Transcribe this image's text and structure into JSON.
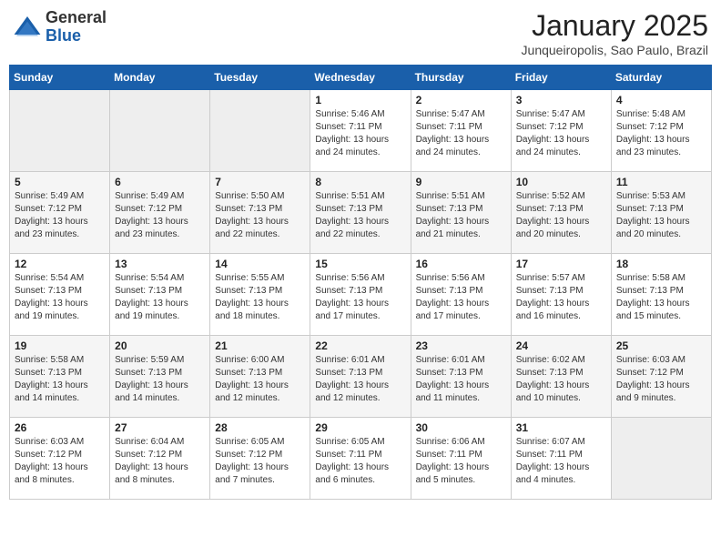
{
  "header": {
    "logo": {
      "general": "General",
      "blue": "Blue"
    },
    "title": "January 2025",
    "subtitle": "Junqueiropolis, Sao Paulo, Brazil"
  },
  "weekdays": [
    "Sunday",
    "Monday",
    "Tuesday",
    "Wednesday",
    "Thursday",
    "Friday",
    "Saturday"
  ],
  "weeks": [
    [
      {
        "day": "",
        "info": ""
      },
      {
        "day": "",
        "info": ""
      },
      {
        "day": "",
        "info": ""
      },
      {
        "day": "1",
        "info": "Sunrise: 5:46 AM\nSunset: 7:11 PM\nDaylight: 13 hours\nand 24 minutes."
      },
      {
        "day": "2",
        "info": "Sunrise: 5:47 AM\nSunset: 7:11 PM\nDaylight: 13 hours\nand 24 minutes."
      },
      {
        "day": "3",
        "info": "Sunrise: 5:47 AM\nSunset: 7:12 PM\nDaylight: 13 hours\nand 24 minutes."
      },
      {
        "day": "4",
        "info": "Sunrise: 5:48 AM\nSunset: 7:12 PM\nDaylight: 13 hours\nand 23 minutes."
      }
    ],
    [
      {
        "day": "5",
        "info": "Sunrise: 5:49 AM\nSunset: 7:12 PM\nDaylight: 13 hours\nand 23 minutes."
      },
      {
        "day": "6",
        "info": "Sunrise: 5:49 AM\nSunset: 7:12 PM\nDaylight: 13 hours\nand 23 minutes."
      },
      {
        "day": "7",
        "info": "Sunrise: 5:50 AM\nSunset: 7:13 PM\nDaylight: 13 hours\nand 22 minutes."
      },
      {
        "day": "8",
        "info": "Sunrise: 5:51 AM\nSunset: 7:13 PM\nDaylight: 13 hours\nand 22 minutes."
      },
      {
        "day": "9",
        "info": "Sunrise: 5:51 AM\nSunset: 7:13 PM\nDaylight: 13 hours\nand 21 minutes."
      },
      {
        "day": "10",
        "info": "Sunrise: 5:52 AM\nSunset: 7:13 PM\nDaylight: 13 hours\nand 20 minutes."
      },
      {
        "day": "11",
        "info": "Sunrise: 5:53 AM\nSunset: 7:13 PM\nDaylight: 13 hours\nand 20 minutes."
      }
    ],
    [
      {
        "day": "12",
        "info": "Sunrise: 5:54 AM\nSunset: 7:13 PM\nDaylight: 13 hours\nand 19 minutes."
      },
      {
        "day": "13",
        "info": "Sunrise: 5:54 AM\nSunset: 7:13 PM\nDaylight: 13 hours\nand 19 minutes."
      },
      {
        "day": "14",
        "info": "Sunrise: 5:55 AM\nSunset: 7:13 PM\nDaylight: 13 hours\nand 18 minutes."
      },
      {
        "day": "15",
        "info": "Sunrise: 5:56 AM\nSunset: 7:13 PM\nDaylight: 13 hours\nand 17 minutes."
      },
      {
        "day": "16",
        "info": "Sunrise: 5:56 AM\nSunset: 7:13 PM\nDaylight: 13 hours\nand 17 minutes."
      },
      {
        "day": "17",
        "info": "Sunrise: 5:57 AM\nSunset: 7:13 PM\nDaylight: 13 hours\nand 16 minutes."
      },
      {
        "day": "18",
        "info": "Sunrise: 5:58 AM\nSunset: 7:13 PM\nDaylight: 13 hours\nand 15 minutes."
      }
    ],
    [
      {
        "day": "19",
        "info": "Sunrise: 5:58 AM\nSunset: 7:13 PM\nDaylight: 13 hours\nand 14 minutes."
      },
      {
        "day": "20",
        "info": "Sunrise: 5:59 AM\nSunset: 7:13 PM\nDaylight: 13 hours\nand 14 minutes."
      },
      {
        "day": "21",
        "info": "Sunrise: 6:00 AM\nSunset: 7:13 PM\nDaylight: 13 hours\nand 12 minutes."
      },
      {
        "day": "22",
        "info": "Sunrise: 6:01 AM\nSunset: 7:13 PM\nDaylight: 13 hours\nand 12 minutes."
      },
      {
        "day": "23",
        "info": "Sunrise: 6:01 AM\nSunset: 7:13 PM\nDaylight: 13 hours\nand 11 minutes."
      },
      {
        "day": "24",
        "info": "Sunrise: 6:02 AM\nSunset: 7:13 PM\nDaylight: 13 hours\nand 10 minutes."
      },
      {
        "day": "25",
        "info": "Sunrise: 6:03 AM\nSunset: 7:12 PM\nDaylight: 13 hours\nand 9 minutes."
      }
    ],
    [
      {
        "day": "26",
        "info": "Sunrise: 6:03 AM\nSunset: 7:12 PM\nDaylight: 13 hours\nand 8 minutes."
      },
      {
        "day": "27",
        "info": "Sunrise: 6:04 AM\nSunset: 7:12 PM\nDaylight: 13 hours\nand 8 minutes."
      },
      {
        "day": "28",
        "info": "Sunrise: 6:05 AM\nSunset: 7:12 PM\nDaylight: 13 hours\nand 7 minutes."
      },
      {
        "day": "29",
        "info": "Sunrise: 6:05 AM\nSunset: 7:11 PM\nDaylight: 13 hours\nand 6 minutes."
      },
      {
        "day": "30",
        "info": "Sunrise: 6:06 AM\nSunset: 7:11 PM\nDaylight: 13 hours\nand 5 minutes."
      },
      {
        "day": "31",
        "info": "Sunrise: 6:07 AM\nSunset: 7:11 PM\nDaylight: 13 hours\nand 4 minutes."
      },
      {
        "day": "",
        "info": ""
      }
    ]
  ]
}
